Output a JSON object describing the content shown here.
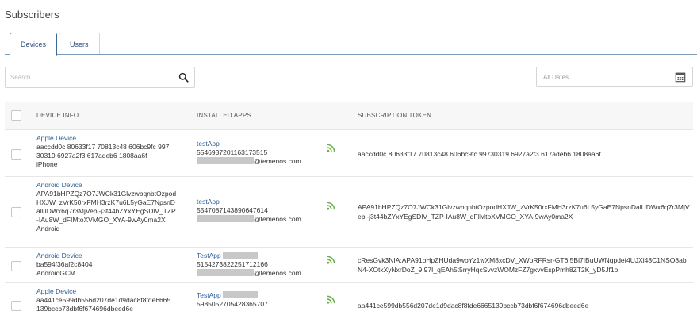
{
  "page": {
    "title": "Subscribers"
  },
  "tabs": [
    {
      "label": "Devices",
      "active": true
    },
    {
      "label": "Users",
      "active": false
    }
  ],
  "search": {
    "placeholder": "Search..."
  },
  "date_filter": {
    "placeholder": "All Dates"
  },
  "table": {
    "headers": [
      "DEVICE INFO",
      "INSTALLED APPS",
      "SUBSCRIPTION TOKEN"
    ],
    "rows": [
      {
        "device_type": "Apple Device",
        "device_lines": [
          "aaccdd0c 80633f17 70813c48 606bc9fc 997",
          "30319 6927a2f3 617adeb6 1808aa6f",
          "iPhone"
        ],
        "app_name": "testApp",
        "app_id": "554693720116317351​5",
        "app_email": "@temenos.com",
        "token": "aaccdd0c 80633f17 70813c48 606bc9fc 99730319 6927a2f3 617adeb6 1808aa6f"
      },
      {
        "device_type": "Android Device",
        "device_lines": [
          "APA91bHPZQz7O7JWCk31GlvzwbqnbtOzpod",
          "HXJW_zVrK50rxFMH3rzK7u6L5yGaE7NpsnD",
          "alUDWx6q7r3MjVebl-j3t44bZYxYEgSDlV_TZP",
          "-IAu8W_dFIMtoXVMGO_XYA-9wAy0ma2X",
          "Android"
        ],
        "app_name": "testApp",
        "app_id": "5547087143890647614",
        "app_email": "@temenos.com",
        "token": "APA91bHPZQz7O7JWCk31GlvzwbqnbtOzpodHXJW_zVrK50rxFMH3rzK7u6L5yGaE7NpsnDalUDWx6q7r3MjVebl-j3t44bZYxYEgSDlV_TZP-IAu8W_dFIMtoXVMGO_XYA-9wAy0ma2X"
      },
      {
        "device_type": "Android Device",
        "device_lines": [
          "ba594f36af2c8404",
          "AndroidGCM"
        ],
        "app_name": "TestApp",
        "app_id": "5154273822251712166",
        "app_email": "@temenos.com",
        "token": "cResGvk3NIA:APA91bHpZHUda9woYz1wXM8xcDV_XWpRFRsr-GT6I5Bi7IBuUWNqpdef4UJXi48C1NSO8abN4-XOtkXyNxrDoZ_9I97I_qEAh5t5rryHqcSvvzWOMzFZ7gxvvEspPmh8ZT2K_yD5Jf1o"
      },
      {
        "device_type": "Apple Device",
        "device_lines": [
          "aa441ce599db556d207de1d9dac8f8fde6665",
          "139bccb73dbf6f674696dbeed6e"
        ],
        "app_name": "TestApp",
        "app_id": "5985052705428365707",
        "app_email": "",
        "token": "aa441ce599db556d207de1d9dac8f8fde6665139bccb73dbf6f674696dbeed6e"
      }
    ]
  },
  "colors": {
    "accent": "#2d5f9b",
    "rss": "#6ab04c",
    "tab_border": "#3a6b96"
  },
  "icons": {
    "search": "search-icon",
    "calendar": "calendar-icon",
    "rss": "rss-icon"
  }
}
